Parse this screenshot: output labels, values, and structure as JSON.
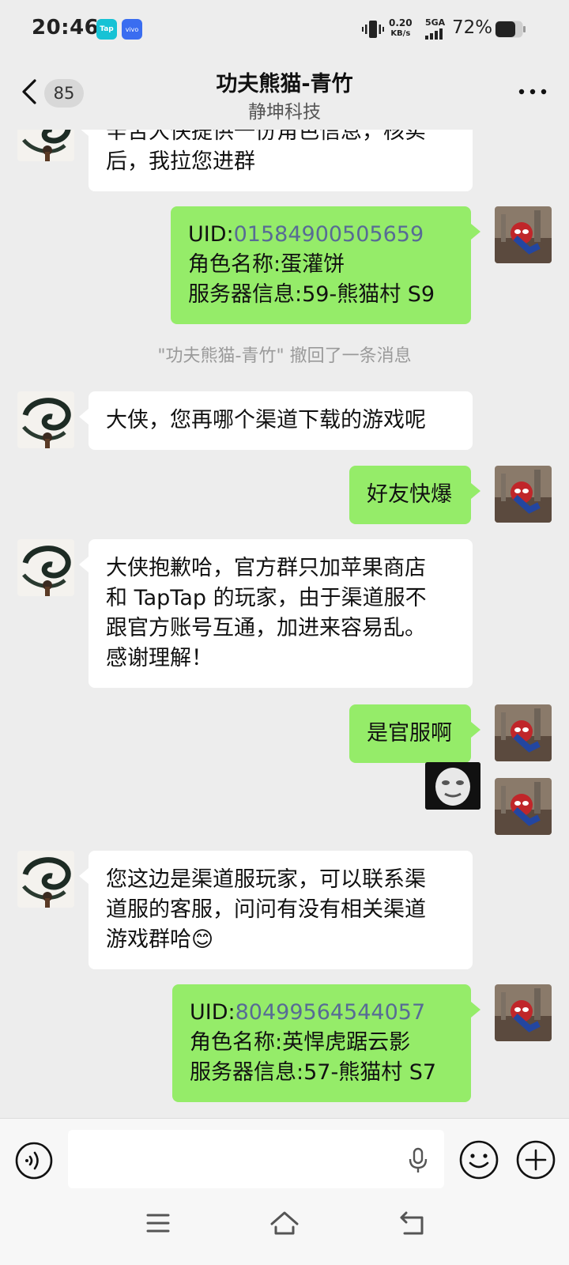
{
  "status_bar": {
    "time": "20:46",
    "app_badges": [
      "Tap",
      "vivo"
    ],
    "net_speed_value": "0.20",
    "net_speed_unit": "KB/s",
    "network": "5GA",
    "battery_percent": "72%"
  },
  "header": {
    "unread_count": "85",
    "title": "功夫熊猫-青竹",
    "subtitle": "静坤科技"
  },
  "messages": [
    {
      "side": "left",
      "lines": [
        "辛苦大侠提供一份角色信息，核实",
        "后，我拉您进群"
      ]
    },
    {
      "side": "right",
      "uid_label": "UID:",
      "uid": "01584900505659",
      "lines": [
        "角色名称:蛋灌饼",
        "服务器信息:59-熊猫村 S9"
      ]
    },
    {
      "type": "system",
      "text": "\"功夫熊猫-青竹\" 撤回了一条消息"
    },
    {
      "side": "left",
      "text": "大侠，您再哪个渠道下载的游戏呢"
    },
    {
      "side": "right",
      "text": "好友快爆"
    },
    {
      "side": "left",
      "lines": [
        "大侠抱歉哈，官方群只加苹果商店",
        "和 TapTap 的玩家，由于渠道服不",
        "跟官方账号互通，加进来容易乱。",
        "感谢理解！"
      ]
    },
    {
      "side": "right",
      "text": "是官服啊"
    },
    {
      "side": "right",
      "type": "sticker",
      "icon": "meme-face-sticker"
    },
    {
      "side": "left",
      "lines": [
        "您这边是渠道服玩家，可以联系渠",
        "道服的客服，问问有没有相关渠道",
        "游戏群哈"
      ],
      "emoji": "😊"
    },
    {
      "side": "right",
      "uid_label": "UID:",
      "uid": "80499564544057",
      "lines": [
        "角色名称:英悍虎踞云影",
        "服务器信息:57-熊猫村 S7"
      ]
    }
  ],
  "input": {
    "value": "",
    "placeholder": ""
  },
  "icons": {
    "back": "chevron-left-icon",
    "more": "more-dots-icon",
    "voice": "voice-icon",
    "mic": "microphone-icon",
    "emoji": "emoji-icon",
    "plus": "plus-icon",
    "nav_menu": "menu-icon",
    "nav_home": "home-icon",
    "nav_back": "back-arrow-icon"
  },
  "colors": {
    "background": "#ededed",
    "bubble_sent": "#95ec69",
    "bubble_received": "#ffffff",
    "uid_link": "#576b95"
  }
}
